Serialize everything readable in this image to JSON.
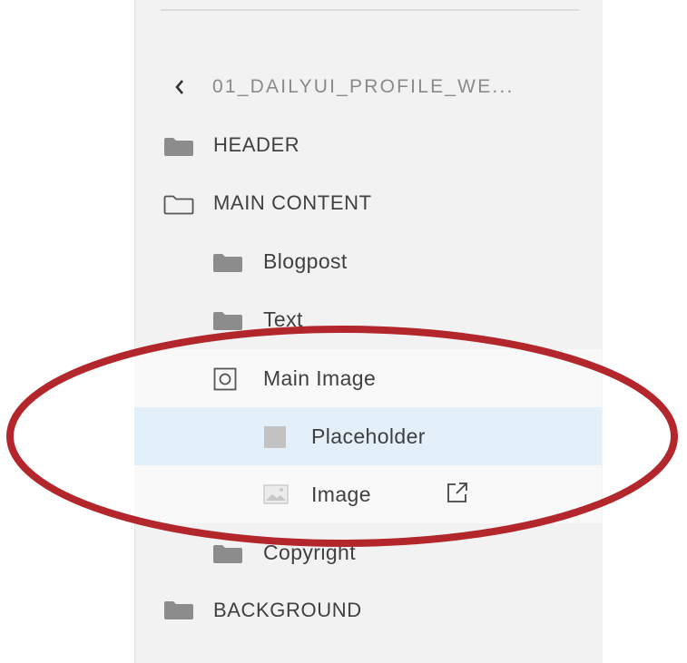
{
  "layers_panel": {
    "breadcrumb": "01_DAILYUI_PROFILE_WE...",
    "items": [
      {
        "label": "HEADER",
        "icon": "folder-filled-icon"
      },
      {
        "label": "MAIN CONTENT",
        "icon": "folder-open-icon"
      },
      {
        "label": "Blogpost",
        "icon": "folder-filled-icon"
      },
      {
        "label": "Text",
        "icon": "folder-filled-icon"
      },
      {
        "label": "Main Image",
        "icon": "mask-group-icon"
      },
      {
        "label": "Placeholder",
        "icon": "rectangle-icon"
      },
      {
        "label": "Image",
        "icon": "image-icon"
      },
      {
        "label": "Copyright",
        "icon": "folder-filled-icon"
      },
      {
        "label": "BACKGROUND",
        "icon": "folder-filled-icon"
      }
    ]
  },
  "colors": {
    "panel_background": "#f2f2f2",
    "selected_row": "#e3eff9",
    "annotation_ellipse": "#b3262b",
    "text": "#404040",
    "icon": "#8c8c8c"
  }
}
